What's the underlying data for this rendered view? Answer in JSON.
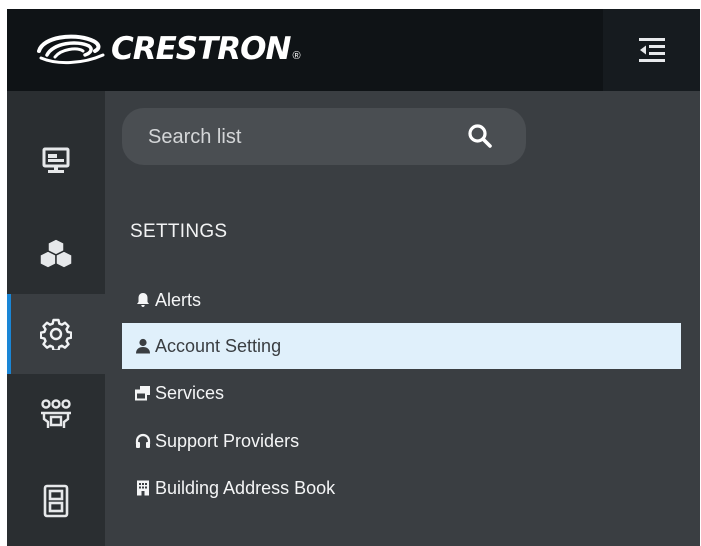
{
  "brand": {
    "name": "CRESTRON",
    "registered": "®"
  },
  "header": {
    "collapse_icon": "collapse-menu-icon"
  },
  "rail": {
    "items": [
      {
        "icon": "display-icon",
        "active": false
      },
      {
        "icon": "cubes-icon",
        "active": false
      },
      {
        "icon": "gear-icon",
        "active": true
      },
      {
        "icon": "users-icon",
        "active": false
      },
      {
        "icon": "cabinet-icon",
        "active": false
      }
    ]
  },
  "search": {
    "placeholder": "Search list",
    "icon": "search-icon"
  },
  "settings": {
    "heading": "SETTINGS",
    "items": [
      {
        "label": "Alerts",
        "icon": "bell-icon",
        "selected": false
      },
      {
        "label": "Account Setting",
        "icon": "user-icon",
        "selected": true
      },
      {
        "label": "Services",
        "icon": "windows-icon",
        "selected": false
      },
      {
        "label": "Support Providers",
        "icon": "headphones-icon",
        "selected": false
      },
      {
        "label": "Building Address Book",
        "icon": "building-icon",
        "selected": false
      }
    ]
  },
  "colors": {
    "topbar": "#0f1316",
    "rail": "#2a2e31",
    "panel": "#3a3e42",
    "accent": "#1a86d6",
    "selected_row": "#e0f0fb"
  }
}
